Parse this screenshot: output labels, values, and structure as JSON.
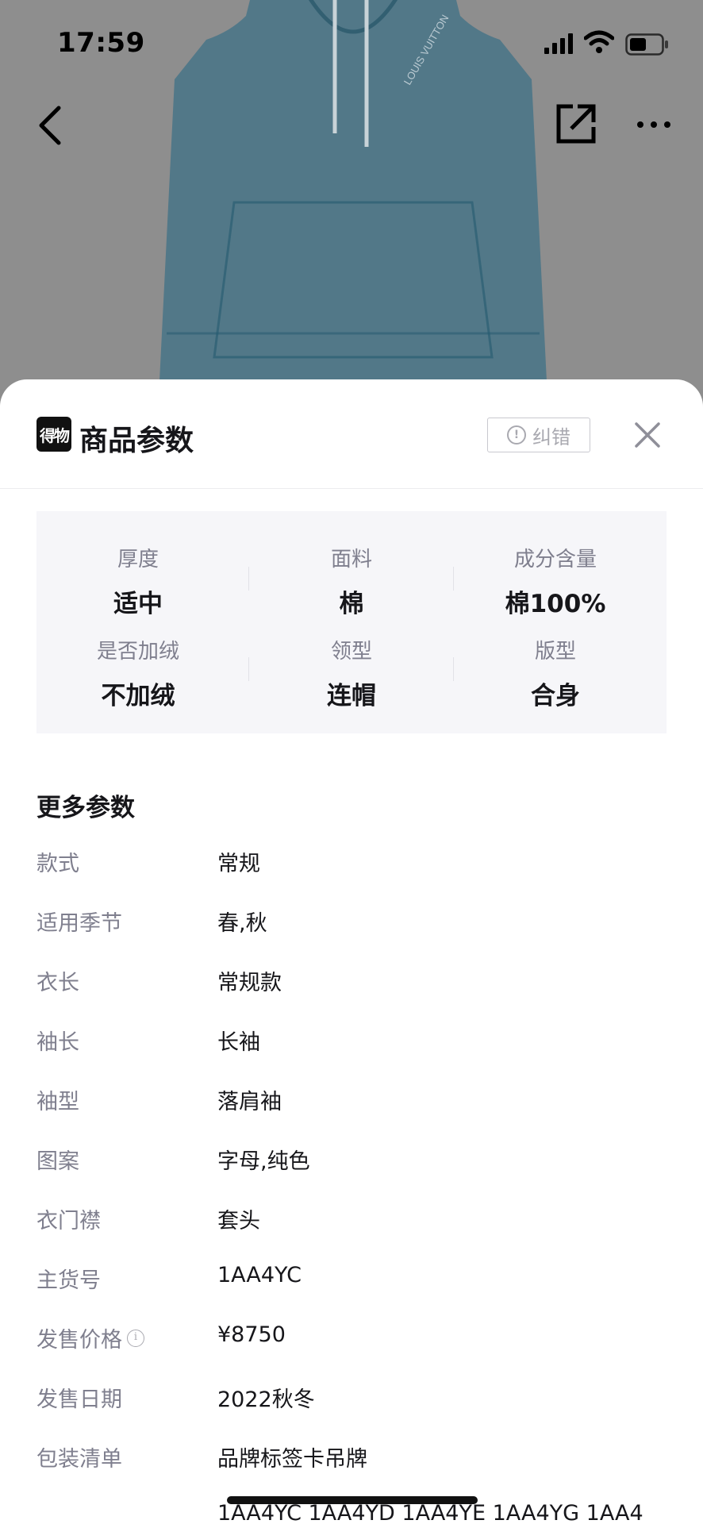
{
  "status_bar": {
    "time": "17:59"
  },
  "sheet": {
    "title": "商品参数",
    "logo_text": "得物",
    "report_label": "纠错"
  },
  "key_params": [
    {
      "label": "厚度",
      "value": "适中"
    },
    {
      "label": "面料",
      "value": "棉"
    },
    {
      "label": "成分含量",
      "value": "棉100%"
    },
    {
      "label": "是否加绒",
      "value": "不加绒"
    },
    {
      "label": "领型",
      "value": "连帽"
    },
    {
      "label": "版型",
      "value": "合身"
    }
  ],
  "more_params": {
    "title": "更多参数",
    "rows": [
      {
        "key": "款式",
        "value": "常规"
      },
      {
        "key": "适用季节",
        "value": "春,秋"
      },
      {
        "key": "衣长",
        "value": "常规款"
      },
      {
        "key": "袖长",
        "value": "长袖"
      },
      {
        "key": "袖型",
        "value": "落肩袖"
      },
      {
        "key": "图案",
        "value": "字母,纯色"
      },
      {
        "key": "衣门襟",
        "value": "套头"
      },
      {
        "key": "主货号",
        "value": "1AA4YC"
      },
      {
        "key": "发售价格",
        "value": "¥8750",
        "info_icon": "i"
      },
      {
        "key": "发售日期",
        "value": "2022秋冬"
      },
      {
        "key": "包装清单",
        "value": "品牌标签卡吊牌"
      },
      {
        "key": "",
        "value": "1AA4YC 1AA4YD 1AA4YE 1AA4YG 1AA4"
      }
    ]
  },
  "photo": {
    "print_text": "LOUIS VUITTON"
  },
  "colors": {
    "hoodie": "#2f6f8a",
    "overlay": "#8e8e8e",
    "text_primary": "#16161a",
    "text_secondary": "#7f7f8e"
  },
  "icons": [
    "back-chevron-icon",
    "share-icon",
    "more-icon",
    "close-icon",
    "alert-circle-icon",
    "info-icon",
    "signal-icon",
    "wifi-icon",
    "battery-icon"
  ]
}
